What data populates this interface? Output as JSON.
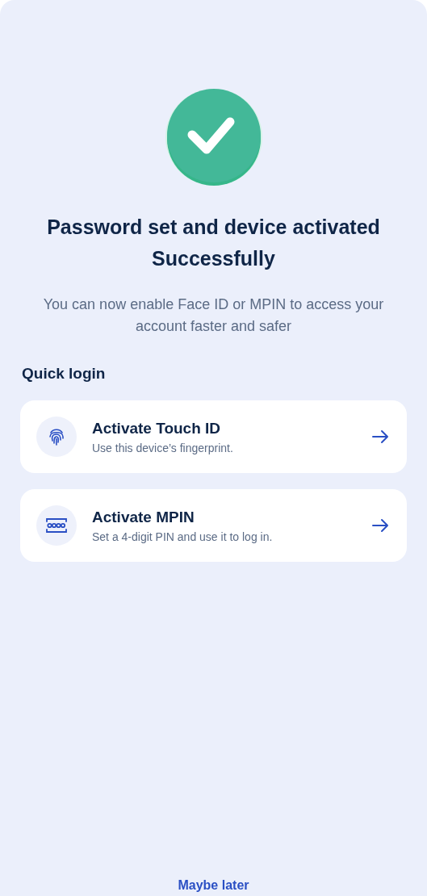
{
  "title": "Password set and device activated Successfully",
  "subtitle": "You can now enable Face ID or MPIN to access your account faster and safer",
  "section_title": "Quick login",
  "options": [
    {
      "kind": "fingerprint",
      "title": "Activate Touch ID",
      "description": "Use this device’s fingerprint."
    },
    {
      "kind": "pin",
      "title": "Activate MPIN",
      "description": "Set a 4-digit PIN and use it to log in."
    }
  ],
  "secondary_action": "Maybe later"
}
